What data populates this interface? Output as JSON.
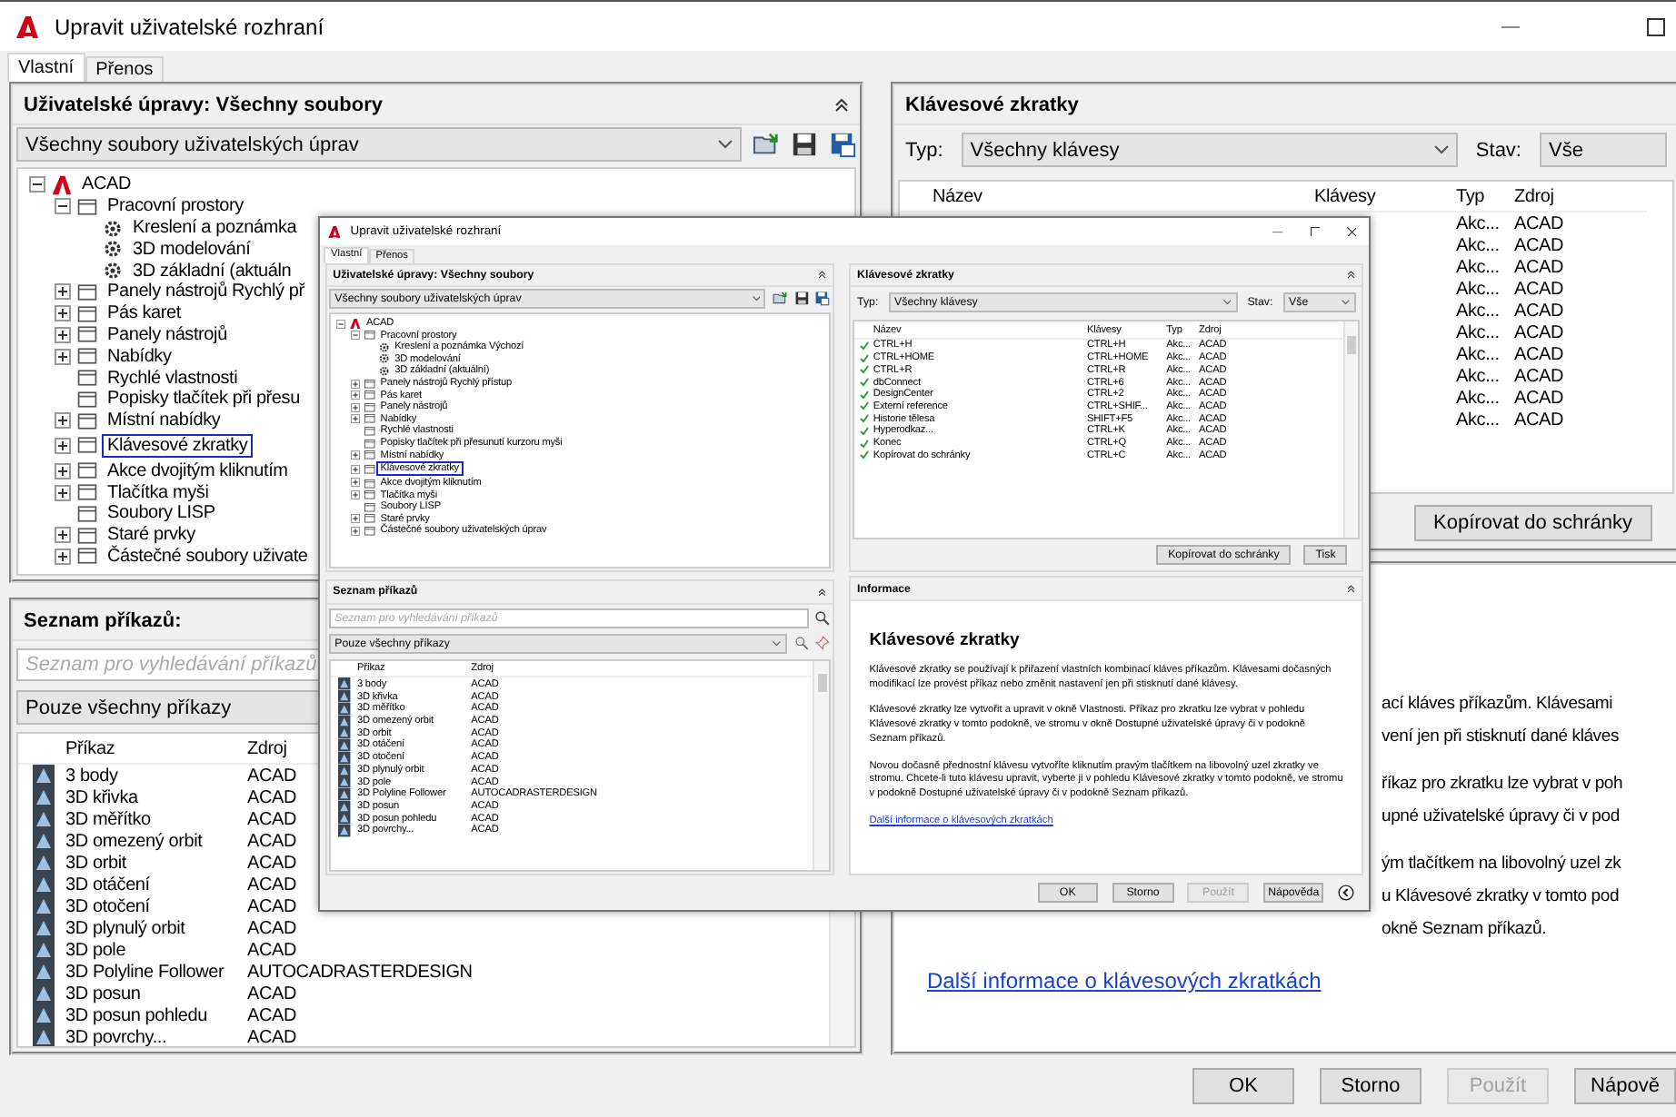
{
  "window": {
    "title": "Upravit uživatelské rozhraní",
    "tabs": [
      {
        "label": "Vlastní",
        "selected": true
      },
      {
        "label": "Přenos",
        "selected": false
      }
    ],
    "customizations": {
      "title": "Uživatelské úpravy: Všechny soubory",
      "file_select": "Všechny soubory uživatelských úprav",
      "tree": [
        {
          "label": "ACAD",
          "expanded": true,
          "marked": false,
          "children": [
            {
              "label": "Pracovní prostory",
              "expanded": true,
              "marked": false,
              "children": [
                {
                  "label": "Kreslení a poznámka",
                  "marked": false
                },
                {
                  "label": "3D modelování",
                  "marked": false
                },
                {
                  "label": "3D základní (aktuáln",
                  "marked": false
                }
              ]
            },
            {
              "label": "Panely nástrojů Rychlý př",
              "expanded": false,
              "marked": false
            },
            {
              "label": "Pás karet",
              "expanded": false,
              "marked": false
            },
            {
              "label": "Panely nástrojů",
              "expanded": false,
              "marked": false
            },
            {
              "label": "Nabídky",
              "expanded": false,
              "marked": false
            },
            {
              "label": "Rychlé vlastnosti",
              "marked": false
            },
            {
              "label": "Popisky tlačítek při přesu",
              "marked": false
            },
            {
              "label": "Místní nabídky",
              "expanded": false,
              "marked": false
            },
            {
              "label": "Klávesové zkratky",
              "expanded": false,
              "marked": true
            },
            {
              "label": "Akce dvojitým kliknutím",
              "expanded": false,
              "marked": false
            },
            {
              "label": "Tlačítka myši",
              "expanded": false,
              "marked": false
            },
            {
              "label": "Soubory LISP",
              "marked": false
            },
            {
              "label": "Staré prvky",
              "expanded": false,
              "marked": false
            },
            {
              "label": "Částečné soubory uživate",
              "expanded": false,
              "marked": false
            }
          ]
        }
      ]
    },
    "command_list": {
      "title": "Seznam příkazů:",
      "search": {
        "placeholder": "Seznam pro vyhledávání příkazů"
      },
      "filter": "Pouze všechny příkazy",
      "columns": [
        "Příkaz",
        "Zdroj"
      ],
      "rows": [
        {
          "command": "3 body",
          "source": "ACAD"
        },
        {
          "command": "3D křivka",
          "source": "ACAD"
        },
        {
          "command": "3D měřítko",
          "source": "ACAD"
        },
        {
          "command": "3D omezený orbit",
          "source": "ACAD"
        },
        {
          "command": "3D orbit",
          "source": "ACAD"
        },
        {
          "command": "3D otáčení",
          "source": "ACAD"
        },
        {
          "command": "3D otočení",
          "source": "ACAD"
        },
        {
          "command": "3D plynulý orbit",
          "source": "ACAD"
        },
        {
          "command": "3D pole",
          "source": "ACAD"
        },
        {
          "command": "3D Polyline Follower",
          "source": "AUTOCADRASTERDESIGN"
        },
        {
          "command": "3D posun",
          "source": "ACAD"
        },
        {
          "command": "3D posun pohledu",
          "source": "ACAD"
        },
        {
          "command": "3D povrchy...",
          "source": "ACAD"
        }
      ]
    },
    "shortcuts": {
      "title": "Klávesové zkratky",
      "type_label": "Typ:",
      "type_value": "Všechny klávesy",
      "state_label": "Stav:",
      "state_value": "Vše",
      "columns": [
        "Název",
        "Klávesy",
        "Typ",
        "Zdroj"
      ],
      "rows": [
        {
          "type": "Akc...",
          "source": "ACAD"
        },
        {
          "type": "Akc...",
          "source": "ACAD"
        },
        {
          "type": "Akc...",
          "source": "ACAD"
        },
        {
          "type": "Akc...",
          "source": "ACAD"
        },
        {
          "type": "Akc...",
          "source": "ACAD"
        },
        {
          "type": "Akc...",
          "source": "ACAD"
        },
        {
          "type": "Akc...",
          "source": "ACAD"
        },
        {
          "type": "Akc...",
          "source": "ACAD"
        },
        {
          "type": "Akc...",
          "source": "ACAD"
        },
        {
          "type": "Akc...",
          "source": "ACAD"
        }
      ],
      "buttons": [
        "Kopírovat do schránky"
      ]
    },
    "information": {
      "lines": [
        [
          "ací kláves příkazům. Klávesami",
          "vení jen při stisknutí dané kláves"
        ],
        [
          "říkaz pro zkratku lze vybrat v poh",
          "upné uživatelské úpravy či v pod"
        ],
        [
          "ým tlačítkem na libovolný uzel zk",
          "u Klávesové zkratky v tomto pod",
          "okně Seznam příkazů."
        ]
      ],
      "link": "Další informace o klávesových zkratkách"
    },
    "buttons": [
      {
        "label": "OK",
        "disabled": false
      },
      {
        "label": "Storno",
        "disabled": false
      },
      {
        "label": "Použít",
        "disabled": true
      },
      {
        "label": "Nápově",
        "disabled": false
      }
    ]
  },
  "embedded_window": {
    "title": "Upravit uživatelské rozhraní",
    "tabs": [
      {
        "label": "Vlastní",
        "selected": true
      },
      {
        "label": "Přenos",
        "selected": false
      }
    ],
    "customizations": {
      "title": "Uživatelské úpravy: Všechny soubory",
      "file_select": "Všechny soubory uživatelských úprav",
      "tree": [
        {
          "label": "ACAD",
          "expanded": true,
          "marked": false,
          "children": [
            {
              "label": "Pracovní prostory",
              "expanded": true,
              "marked": false,
              "children": [
                {
                  "label": "Kreslení a poznámka Výchozí",
                  "marked": false
                },
                {
                  "label": "3D modelování",
                  "marked": false
                },
                {
                  "label": "3D základní (aktuální)",
                  "marked": false
                }
              ]
            },
            {
              "label": "Panely nástrojů Rychlý přístup",
              "expanded": false,
              "marked": false
            },
            {
              "label": "Pás karet",
              "expanded": false,
              "marked": false
            },
            {
              "label": "Panely nástrojů",
              "expanded": false,
              "marked": false
            },
            {
              "label": "Nabídky",
              "expanded": false,
              "marked": false
            },
            {
              "label": "Rychlé vlastnosti",
              "marked": false
            },
            {
              "label": "Popisky tlačítek při přesunutí kurzoru myši",
              "marked": false
            },
            {
              "label": "Místní nabídky",
              "expanded": false,
              "marked": false
            },
            {
              "label": "Klávesové zkratky",
              "expanded": false,
              "marked": true
            },
            {
              "label": "Akce dvojitým kliknutím",
              "expanded": false,
              "marked": false
            },
            {
              "label": "Tlačítka myši",
              "expanded": false,
              "marked": false
            },
            {
              "label": "Soubory LISP",
              "marked": false
            },
            {
              "label": "Staré prvky",
              "expanded": false,
              "marked": false
            },
            {
              "label": "Částečné soubory uživatelských úprav",
              "expanded": false,
              "marked": false
            }
          ]
        }
      ]
    },
    "command_list": {
      "title": "Seznam příkazů",
      "search": {
        "placeholder": "Seznam pro vyhledávání příkazů"
      },
      "filter": "Pouze všechny příkazy",
      "columns": [
        "Příkaz",
        "Zdroj"
      ],
      "rows": [
        {
          "command": "3 body",
          "source": "ACAD"
        },
        {
          "command": "3D křivka",
          "source": "ACAD"
        },
        {
          "command": "3D měřítko",
          "source": "ACAD"
        },
        {
          "command": "3D omezený orbit",
          "source": "ACAD"
        },
        {
          "command": "3D orbit",
          "source": "ACAD"
        },
        {
          "command": "3D otáčení",
          "source": "ACAD"
        },
        {
          "command": "3D otočení",
          "source": "ACAD"
        },
        {
          "command": "3D plynulý orbit",
          "source": "ACAD"
        },
        {
          "command": "3D pole",
          "source": "ACAD"
        },
        {
          "command": "3D Polyline Follower",
          "source": "AUTOCADRASTERDESIGN"
        },
        {
          "command": "3D posun",
          "source": "ACAD"
        },
        {
          "command": "3D posun pohledu",
          "source": "ACAD"
        },
        {
          "command": "3D povrchy...",
          "source": "ACAD"
        }
      ]
    },
    "shortcuts": {
      "title": "Klávesové zkratky",
      "type_label": "Typ:",
      "type_value": "Všechny klávesy",
      "state_label": "Stav:",
      "state_value": "Vše",
      "columns": [
        "Název",
        "Klávesy",
        "Typ",
        "Zdroj"
      ],
      "rows": [
        {
          "name": "CTRL+H",
          "keys": "CTRL+H",
          "type": "Akc...",
          "source": "ACAD"
        },
        {
          "name": "CTRL+HOME",
          "keys": "CTRL+HOME",
          "type": "Akc...",
          "source": "ACAD"
        },
        {
          "name": "CTRL+R",
          "keys": "CTRL+R",
          "type": "Akc...",
          "source": "ACAD"
        },
        {
          "name": "dbConnect",
          "keys": "CTRL+6",
          "type": "Akc...",
          "source": "ACAD"
        },
        {
          "name": "DesignCenter",
          "keys": "CTRL+2",
          "type": "Akc...",
          "source": "ACAD"
        },
        {
          "name": "Externí reference",
          "keys": "CTRL+SHIF...",
          "type": "Akc...",
          "source": "ACAD"
        },
        {
          "name": "Historie tělesa",
          "keys": "SHIFT+F5",
          "type": "Akc...",
          "source": "ACAD"
        },
        {
          "name": "Hyperodkaz...",
          "keys": "CTRL+K",
          "type": "Akc...",
          "source": "ACAD"
        },
        {
          "name": "Konec",
          "keys": "CTRL+Q",
          "type": "Akc...",
          "source": "ACAD"
        },
        {
          "name": "Kopírovat do schránky",
          "keys": "CTRL+C",
          "type": "Akc...",
          "source": "ACAD"
        }
      ],
      "buttons": [
        "Kopírovat do schránky",
        "Tisk"
      ]
    },
    "information": {
      "title": "Informace",
      "heading": "Klávesové zkratky",
      "paragraphs": [
        "Klávesové zkratky se používají k přiřazení vlastních kombinací kláves příkazům. Klávesami dočasných modifikací lze provést příkaz nebo změnit nastavení jen při stisknutí dané klávesy.",
        "Klávesové zkratky lze vytvořit a upravit v okně Vlastnosti. Příkaz pro zkratku lze vybrat v pohledu Klávesové zkratky v tomto podokně, ve stromu v okně Dostupné uživatelské úpravy či v podokně Seznam příkazů.",
        "Novou dočasně přednostní klávesu vytvoříte kliknutím pravým tlačítkem na libovolný uzel zkratky ve stromu. Chcete-li tuto klávesu upravit, vyberte ji v pohledu Klávesové zkratky v tomto podokně, ve stromu v podokně Dostupné uživatelské úpravy či v podokně Seznam příkazů."
      ],
      "link": "Další informace o klávesových zkratkách"
    },
    "buttons": [
      {
        "label": "OK",
        "disabled": false
      },
      {
        "label": "Storno",
        "disabled": false
      },
      {
        "label": "Použít",
        "disabled": true
      },
      {
        "label": "Nápověda",
        "disabled": false
      }
    ]
  }
}
